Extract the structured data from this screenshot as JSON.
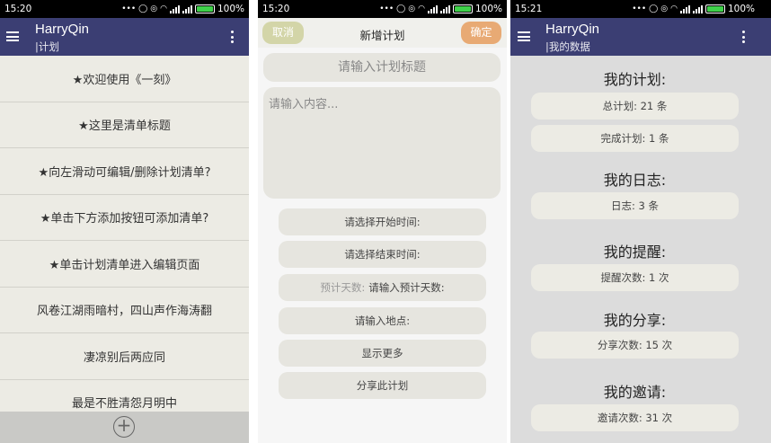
{
  "colors": {
    "appbar": "#3b3e73",
    "list_bg": "#ecebe4",
    "cancel": "#d3d5a8",
    "confirm": "#e8aa74",
    "battery": "#3fd14a"
  },
  "s1": {
    "status_time": "15:20",
    "battery": "100%",
    "app_title": "HarryQin",
    "subtitle": "|计划",
    "items": [
      "★欢迎使用《一刻》",
      "★这里是清单标题",
      "★向左滑动可编辑/删除计划清单?",
      "★单击下方添加按钮可添加清单?",
      "★单击计划清单进入编辑页面",
      "风卷江湖雨暗村，四山声作海涛翻",
      "凄凉别后两应同",
      "最是不胜清怨月明中"
    ],
    "add_icon": "plus-circle-icon",
    "add_symbol": "+"
  },
  "s2": {
    "status_time": "15:20",
    "battery": "100%",
    "cancel": "取消",
    "title": "新增计划",
    "confirm": "确定",
    "title_placeholder": "请输入计划标题",
    "content_placeholder": "请输入内容...",
    "start_time": "请选择开始时间:",
    "end_time": "请选择结束时间:",
    "est_days_hint": "预计天数:",
    "est_days": "请输入预计天数:",
    "location": "请输入地点:",
    "more": "显示更多",
    "share": "分享此计划"
  },
  "s3": {
    "status_time": "15:21",
    "battery": "100%",
    "app_title": "HarryQin",
    "subtitle": "|我的数据",
    "plan_title": "我的计划:",
    "plan_total": "总计划: 21 条",
    "plan_done": "完成计划: 1 条",
    "log_title": "我的日志:",
    "log_count": "日志: 3 条",
    "remind_title": "我的提醒:",
    "remind_count": "提醒次数: 1 次",
    "share_title": "我的分享:",
    "share_count": "分享次数: 15 次",
    "invite_title": "我的邀请:",
    "invite_count": "邀请次数: 31 次"
  }
}
